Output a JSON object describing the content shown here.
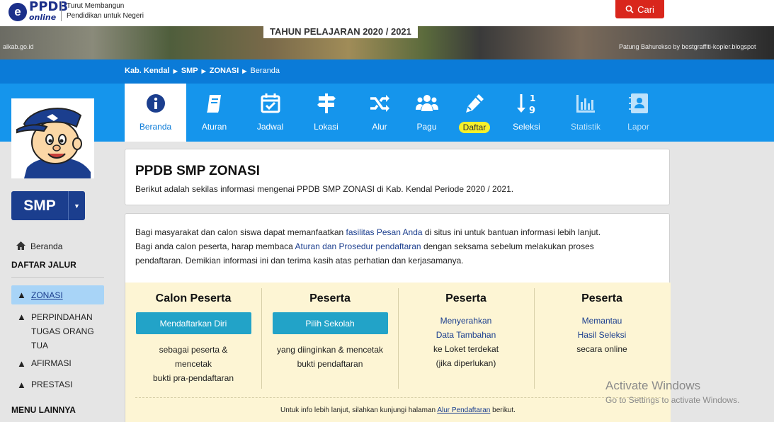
{
  "header": {
    "logo_text": "PPDB",
    "logo_sub": "online",
    "tagline_1": "Turut Membangun",
    "tagline_2": "Pendidikan untuk Negeri",
    "search_button": "Cari"
  },
  "banner": {
    "year": "TAHUN PELAJARAN 2020 / 2021",
    "domain": "alkab.go.id",
    "credit": "Patung Bahurekso by bestgraffiti-kopler.blogspot"
  },
  "breadcrumb": [
    "Kab. Kendal",
    "SMP",
    "ZONASI",
    "Beranda"
  ],
  "nav": [
    {
      "label": "Beranda",
      "icon": "info-icon",
      "active": true
    },
    {
      "label": "Aturan",
      "icon": "book-icon"
    },
    {
      "label": "Jadwal",
      "icon": "calendar-check-icon"
    },
    {
      "label": "Lokasi",
      "icon": "signpost-icon"
    },
    {
      "label": "Alur",
      "icon": "shuffle-icon"
    },
    {
      "label": "Pagu",
      "icon": "users-icon"
    },
    {
      "label": "Daftar",
      "icon": "pencil-icon",
      "highlight": true
    },
    {
      "label": "Seleksi",
      "icon": "sort-numeric-icon"
    },
    {
      "label": "Statistik",
      "icon": "bar-chart-icon",
      "dim": true
    },
    {
      "label": "Lapor",
      "icon": "contact-card-icon",
      "dim": true
    }
  ],
  "sidebar": {
    "level": "SMP",
    "home": "Beranda",
    "section_jalur": "DAFTAR JALUR",
    "jalur": [
      {
        "label": "ZONASI",
        "active": true
      },
      {
        "label_lines": [
          "PERPINDAHAN",
          "TUGAS ORANG",
          "TUA"
        ]
      },
      {
        "label": "AFIRMASI"
      },
      {
        "label": "PRESTASI"
      }
    ],
    "section_lain": "MENU LAINNYA"
  },
  "main": {
    "title": "PPDB SMP ZONASI",
    "subtitle": "Berikut adalah sekilas informasi mengenai PPDB SMP ZONASI di Kab. Kendal Periode 2020 / 2021.",
    "intro_1a": "Bagi masyarakat dan calon siswa dapat memanfaatkan ",
    "intro_1_link": "fasilitas Pesan Anda",
    "intro_1b": " di situs ini untuk bantuan informasi lebih lanjut.",
    "intro_2a": "Bagi anda calon peserta, harap membaca ",
    "intro_2_link": "Aturan dan Prosedur pendaftaran",
    "intro_2b": " dengan seksama sebelum melakukan proses",
    "intro_3": "pendaftaran. Demikian informasi ini dan terima kasih atas perhatian dan kerjasamanya.",
    "steps": [
      {
        "heading": "Calon Peserta",
        "button": "Mendaftarkan Diri",
        "desc": [
          "sebagai peserta &",
          "mencetak",
          "bukti pra-pendaftaran"
        ]
      },
      {
        "heading": "Peserta",
        "button": "Pilih Sekolah",
        "desc": [
          "yang diinginkan & mencetak",
          "bukti pendaftaran"
        ]
      },
      {
        "heading": "Peserta",
        "link": [
          "Menyerahkan",
          "Data Tambahan"
        ],
        "desc": [
          "ke Loket terdekat",
          "(jika diperlukan)"
        ]
      },
      {
        "heading": "Peserta",
        "link": [
          "Memantau",
          "Hasil Seleksi"
        ],
        "desc": [
          "secara online"
        ]
      }
    ],
    "footer_a": "Untuk info lebih lanjut, silahkan kunjungi halaman ",
    "footer_link": "Alur Pendaftaran",
    "footer_b": " berikut."
  },
  "watermark": {
    "line1": "Activate Windows",
    "line2": "Go to Settings to activate Windows."
  }
}
